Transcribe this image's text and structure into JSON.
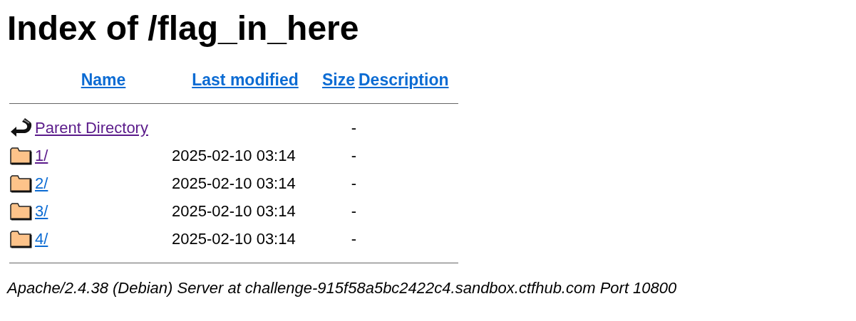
{
  "title": "Index of /flag_in_here",
  "columns": [
    "Name",
    "Last modified",
    "Size",
    "Description"
  ],
  "rows": [
    {
      "kind": "parent",
      "name": "Parent Directory",
      "modified": "",
      "size": "-",
      "visited": true
    },
    {
      "kind": "folder",
      "name": "1/",
      "modified": "2025-02-10 03:14",
      "size": "-",
      "visited": true
    },
    {
      "kind": "folder",
      "name": "2/",
      "modified": "2025-02-10 03:14",
      "size": "-",
      "visited": false
    },
    {
      "kind": "folder",
      "name": "3/",
      "modified": "2025-02-10 03:14",
      "size": "-",
      "visited": false
    },
    {
      "kind": "folder",
      "name": "4/",
      "modified": "2025-02-10 03:14",
      "size": "-",
      "visited": false
    }
  ],
  "footer": "Apache/2.4.38 (Debian) Server at challenge-915f58a5bc2422c4.sandbox.ctfhub.com Port 10800"
}
